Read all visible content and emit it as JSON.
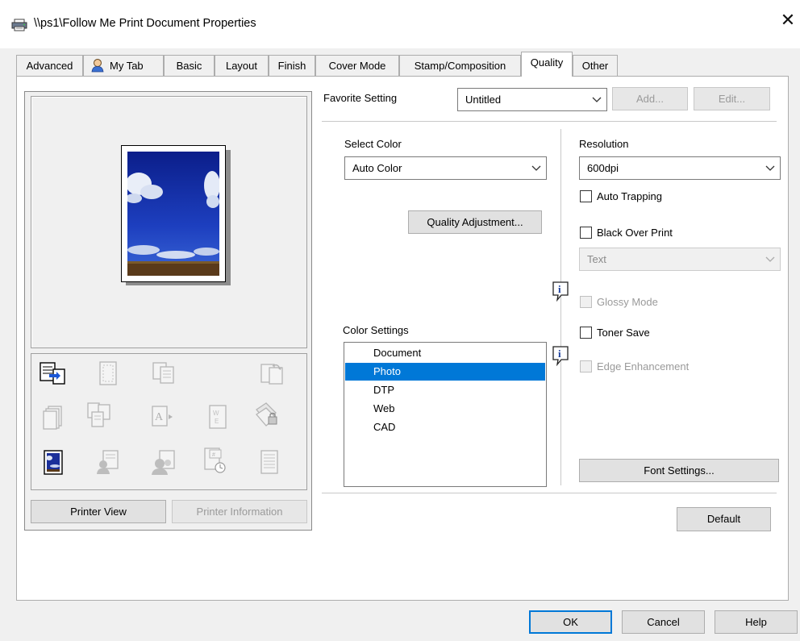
{
  "window": {
    "title": "\\\\ps1\\Follow Me Print Document Properties",
    "close_icon": "close-icon",
    "printer_icon": "printer-icon"
  },
  "tabs": [
    {
      "label": "Advanced",
      "active": false
    },
    {
      "label": "My Tab",
      "active": false,
      "icon": "person-icon"
    },
    {
      "label": "Basic",
      "active": false
    },
    {
      "label": "Layout",
      "active": false
    },
    {
      "label": "Finish",
      "active": false
    },
    {
      "label": "Cover Mode",
      "active": false
    },
    {
      "label": "Stamp/Composition",
      "active": false
    },
    {
      "label": "Quality",
      "active": true
    },
    {
      "label": "Other",
      "active": false
    }
  ],
  "favorite": {
    "label": "Favorite Setting",
    "value": "Untitled",
    "add_label": "Add...",
    "edit_label": "Edit..."
  },
  "select_color": {
    "label": "Select Color",
    "value": "Auto Color"
  },
  "quality_adjustment_label": "Quality Adjustment...",
  "color_settings": {
    "label": "Color Settings",
    "items": [
      "Document",
      "Photo",
      "DTP",
      "Web",
      "CAD"
    ],
    "selected": "Photo"
  },
  "resolution": {
    "label": "Resolution",
    "value": "600dpi"
  },
  "auto_trapping": {
    "label": "Auto Trapping",
    "checked": false
  },
  "black_over_print": {
    "label": "Black Over Print",
    "checked": false,
    "mode_value": "Text"
  },
  "glossy_mode": {
    "label": "Glossy Mode",
    "checked": false,
    "enabled": false
  },
  "toner_save": {
    "label": "Toner Save",
    "checked": false
  },
  "edge_enhancement": {
    "label": "Edge Enhancement",
    "checked": false,
    "enabled": false
  },
  "font_settings_label": "Font Settings...",
  "default_label": "Default",
  "printer_view_label": "Printer View",
  "printer_information_label": "Printer Information",
  "footer": {
    "ok_label": "OK",
    "cancel_label": "Cancel",
    "help_label": "Help"
  },
  "colors": {
    "selection": "#0078d7",
    "dialog_bg": "#f0f0f0",
    "info_icon": "#1c3f9c"
  }
}
